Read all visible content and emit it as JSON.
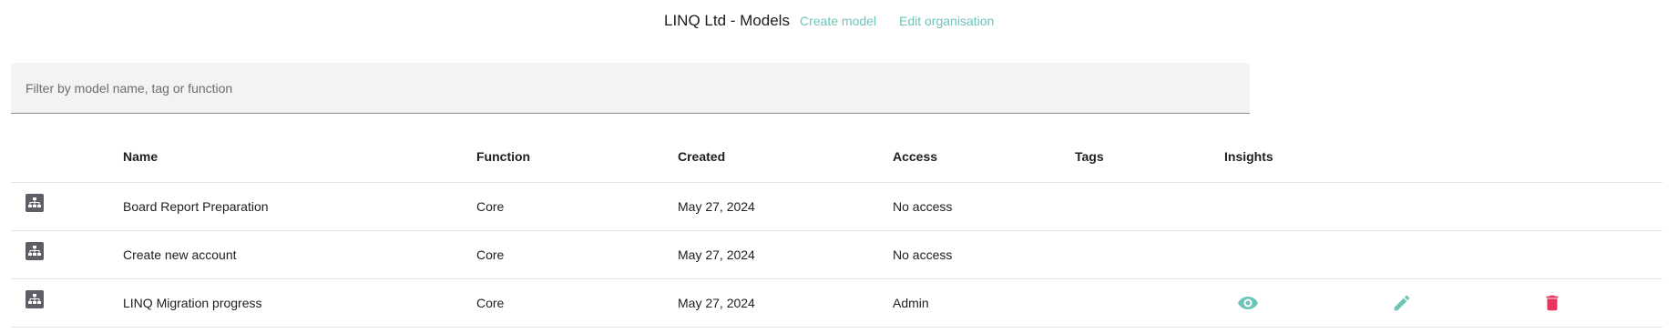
{
  "header": {
    "title": "LINQ Ltd - Models",
    "create_model_label": "Create model",
    "edit_organisation_label": "Edit organisation"
  },
  "filter": {
    "placeholder": "Filter by model name, tag or function",
    "value": ""
  },
  "table": {
    "columns": [
      "",
      "Name",
      "Function",
      "Created",
      "Access",
      "Tags",
      "Insights"
    ],
    "rows": [
      {
        "icon": "model-hierarchy-icon",
        "name": "Board Report Preparation",
        "function": "Core",
        "created": "May 27, 2024",
        "access": "No access",
        "tags": "",
        "actions": []
      },
      {
        "icon": "model-hierarchy-icon",
        "name": "Create new account",
        "function": "Core",
        "created": "May 27, 2024",
        "access": "No access",
        "tags": "",
        "actions": []
      },
      {
        "icon": "model-hierarchy-icon",
        "name": "LINQ Migration progress",
        "function": "Core",
        "created": "May 27, 2024",
        "access": "Admin",
        "tags": "",
        "actions": [
          "view-icon",
          "edit-icon",
          "delete-icon"
        ]
      }
    ]
  },
  "colors": {
    "accent": "#6dc5b7",
    "danger": "#e8335f",
    "icon_gray": "#5e5e66"
  }
}
